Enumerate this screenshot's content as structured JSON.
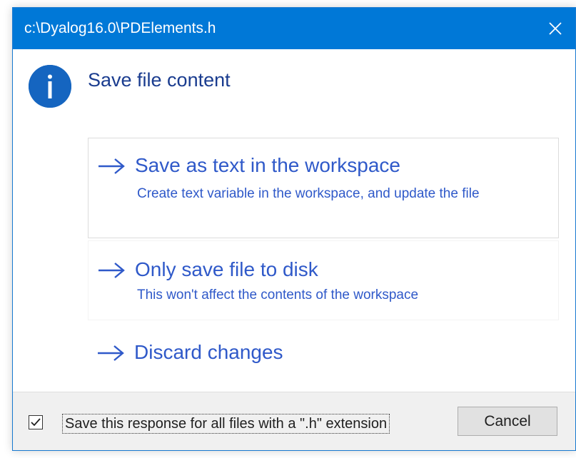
{
  "window": {
    "title": "c:\\Dyalog16.0\\PDElements.h",
    "close_icon": "close-icon"
  },
  "colors": {
    "titlebar": "#0078d7",
    "accent_text": "#2f59c9",
    "heading_text": "#1a3c8f",
    "info_icon": "#1565c0",
    "footer_bg": "#f0f0f0"
  },
  "main": {
    "icon": "info-icon",
    "heading": "Save file content",
    "commands": [
      {
        "icon": "arrow-right-icon",
        "title": "Save as text in the workspace",
        "description": "Create text variable in the workspace, and update the file"
      },
      {
        "icon": "arrow-right-icon",
        "title": "Only save file to disk",
        "description": "This won't affect the contents of the workspace"
      },
      {
        "icon": "arrow-right-icon",
        "title": "Discard changes"
      }
    ]
  },
  "footer": {
    "checkbox_checked": true,
    "checkbox_label": "Save this response for all files with a \".h\" extension",
    "cancel_label": "Cancel"
  }
}
